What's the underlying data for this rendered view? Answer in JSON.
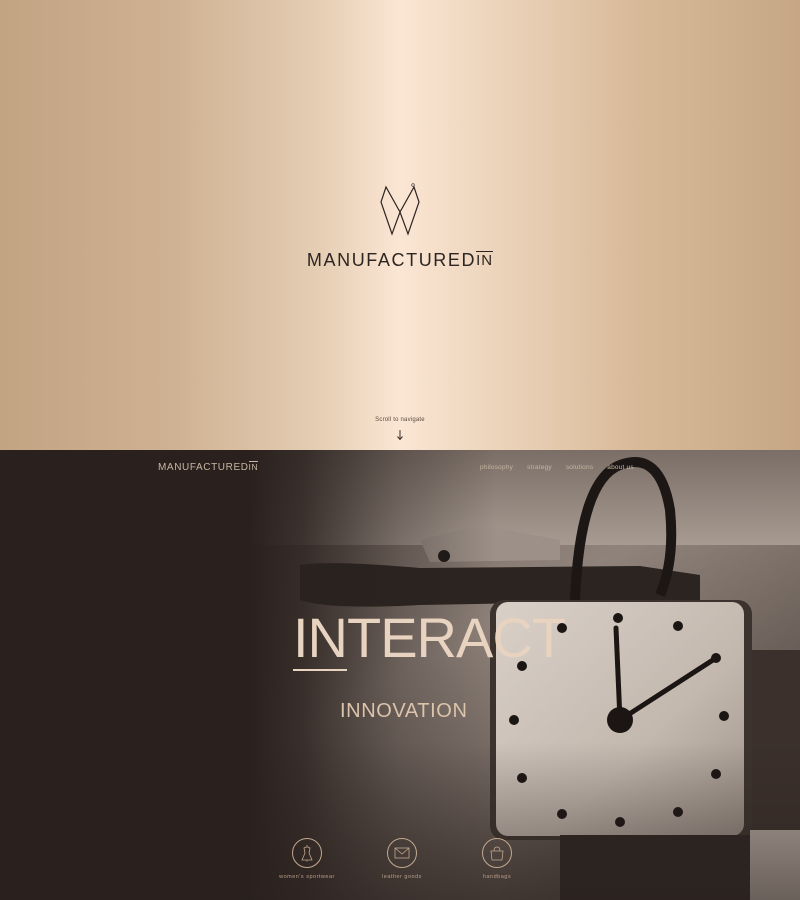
{
  "hero": {
    "brand_main": "MANUFACTURED",
    "brand_in": "IN",
    "scroll_hint": "Scroll to navigate",
    "arrow_icon": "arrow-down-icon"
  },
  "header": {
    "logo_main": "MANUFACTURED",
    "logo_in": "IN",
    "nav": [
      {
        "label": "philosophy"
      },
      {
        "label": "strategy"
      },
      {
        "label": "solutions"
      },
      {
        "label": "about us"
      }
    ]
  },
  "main": {
    "title_underlined": "IN",
    "title_rest": "TERACT",
    "subtitle": "INNOVATION"
  },
  "categories": [
    {
      "label": "women's sportwear",
      "icon": "dress-form-icon"
    },
    {
      "label": "leather goods",
      "icon": "envelope-icon"
    },
    {
      "label": "handbags",
      "icon": "handbag-icon"
    }
  ],
  "colors": {
    "gold_light": "#fbe6d4",
    "gold_dark": "#c2a483",
    "dark_bg": "#2a211e",
    "text_light": "#e7d3bf"
  }
}
